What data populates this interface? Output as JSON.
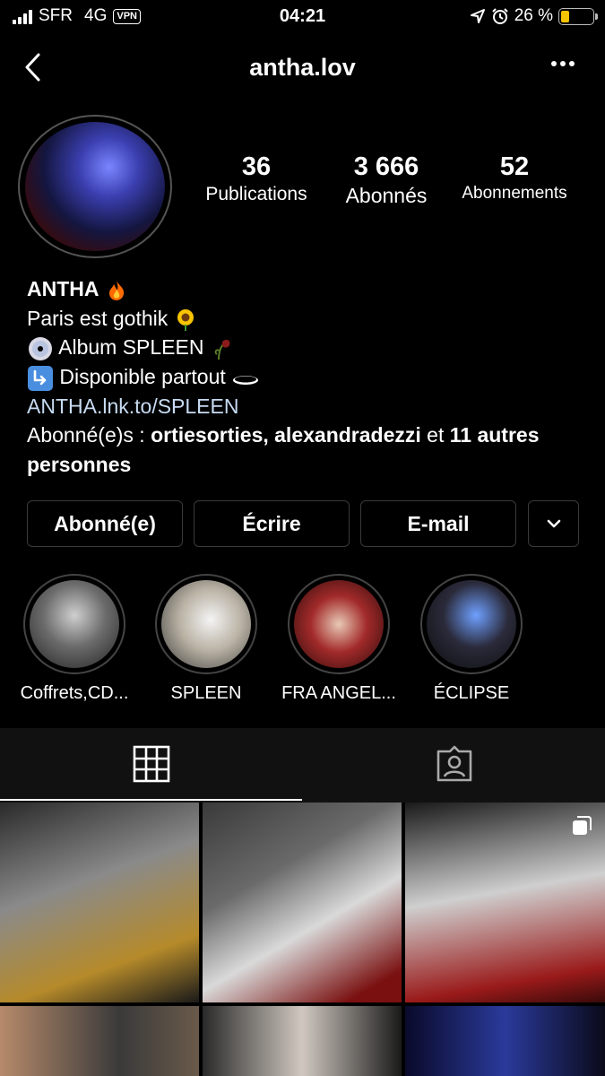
{
  "status_bar": {
    "carrier": "SFR",
    "network": "4G",
    "vpn": "VPN",
    "time": "04:21",
    "battery": "26 %",
    "battery_level": 0.26
  },
  "header": {
    "username": "antha.lov"
  },
  "stats": [
    {
      "value": "36",
      "label": "Publications"
    },
    {
      "value": "3 666",
      "label": "Abonnés"
    },
    {
      "value": "52",
      "label": "Abonnements"
    }
  ],
  "bio": {
    "name": "ANTHA",
    "line1": "Paris est gothik",
    "line2": "Album SPLEEN",
    "line3": "Disponible partout",
    "link": "ANTHA.lnk.to/SPLEEN",
    "followed_prefix": "Abonné(e)s : ",
    "followed_names": "ortiesorties, alexandradezzi",
    "followed_and": " et ",
    "followed_more": "11 autres personnes"
  },
  "actions": {
    "following": "Abonné(e)",
    "message": "Écrire",
    "email": "E-mail"
  },
  "highlights": [
    {
      "label": "Coffrets,CD..."
    },
    {
      "label": "SPLEEN"
    },
    {
      "label": "FRA ANGEL..."
    },
    {
      "label": "ÉCLIPSE"
    }
  ],
  "tabs": {
    "grid_icon": "grid-icon",
    "tagged_icon": "tagged-icon"
  },
  "colors": {
    "background": "#000000",
    "link": "#c7dbf2",
    "button_border": "#3a3a3a",
    "battery": "#f5c400"
  }
}
